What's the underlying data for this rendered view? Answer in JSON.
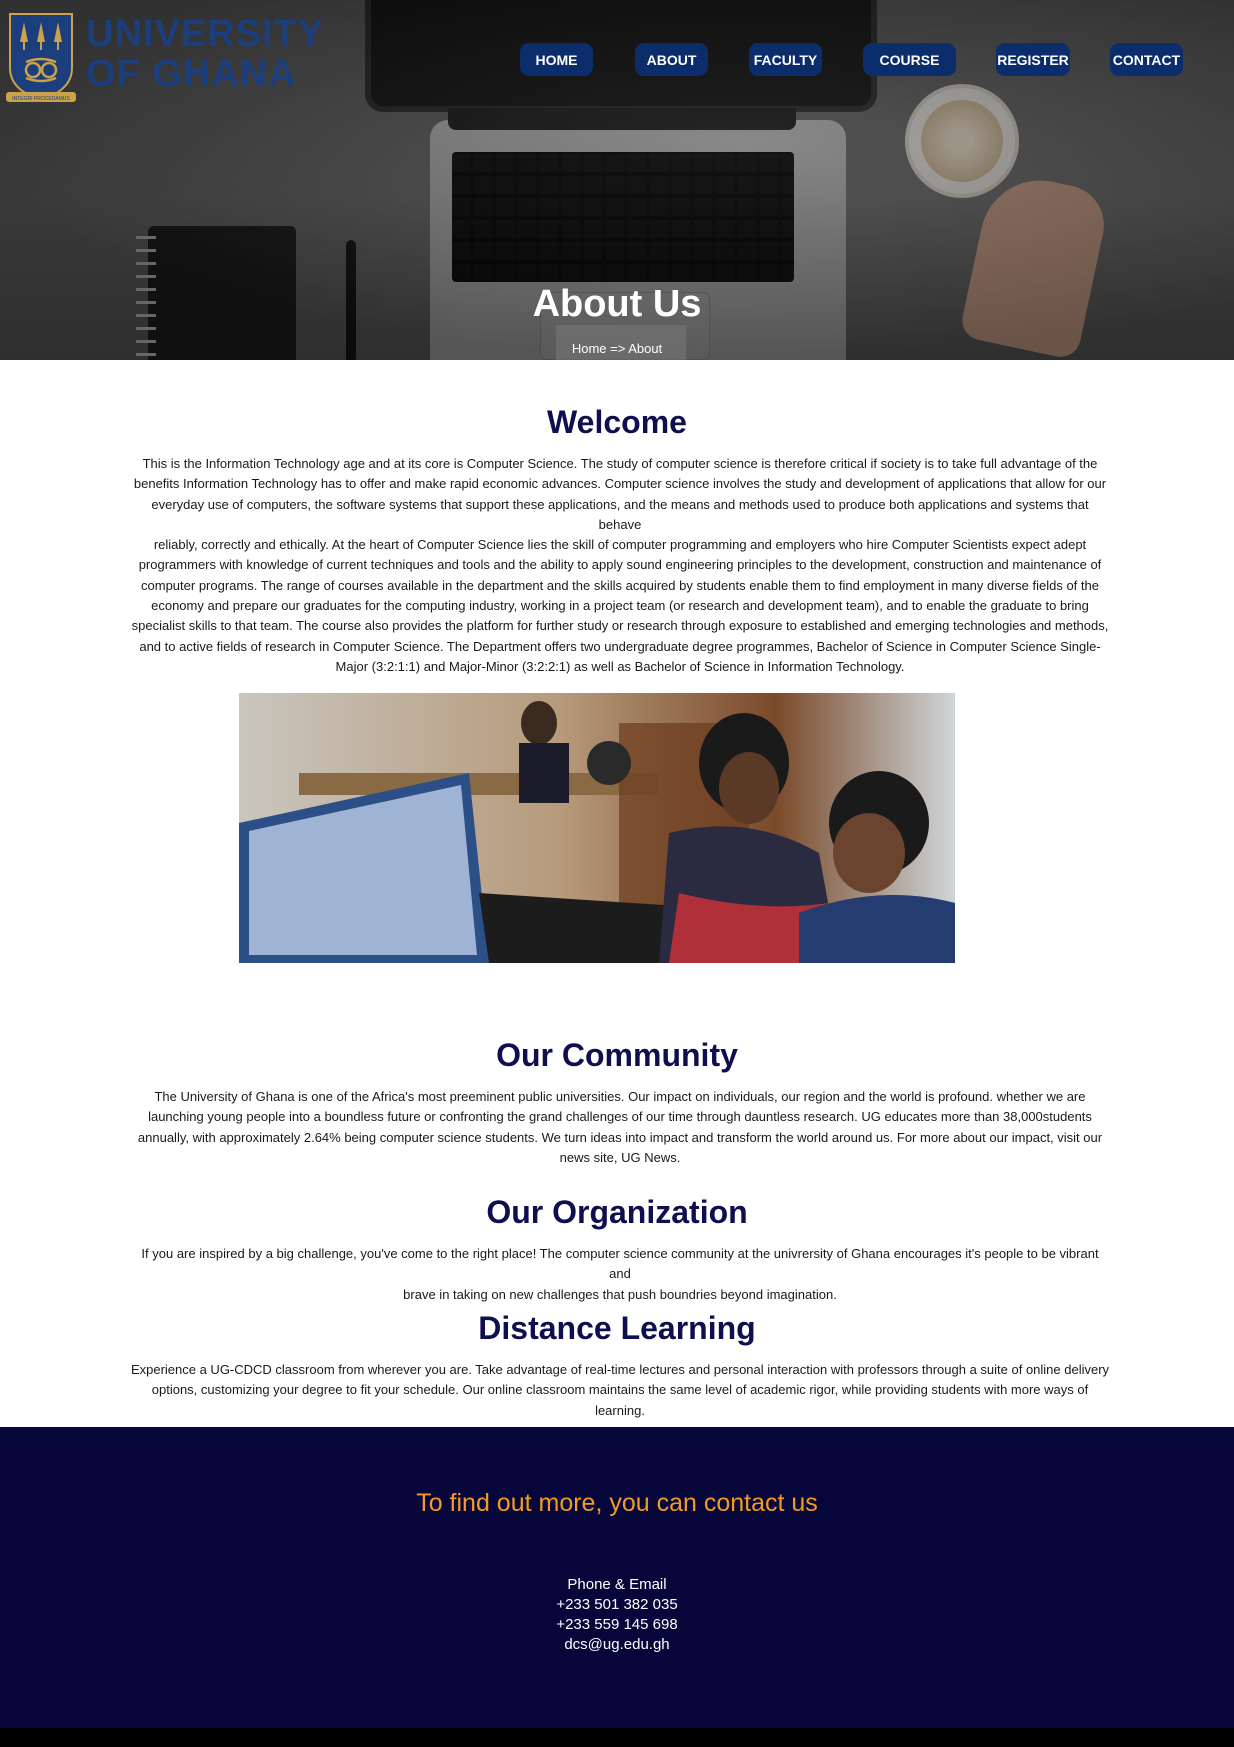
{
  "logo": {
    "line1": "UNIVERSITY",
    "line2": "OF GHANA",
    "motto": "INTEGRI PROCEDAMUS"
  },
  "nav": {
    "items": [
      {
        "label": "HOME"
      },
      {
        "label": "ABOUT"
      },
      {
        "label": "FACULTY"
      },
      {
        "label": "COURSE"
      },
      {
        "label": "REGISTER"
      },
      {
        "label": "CONTACT"
      }
    ]
  },
  "hero": {
    "title": "About Us",
    "breadcrumb": "Home => About"
  },
  "sections": {
    "welcome": {
      "title": "Welcome",
      "lines": [
        "This is the Information Technology age and at its core is Computer Science. The study of computer science is therefore critical if society is to take full advantage of the",
        "benefits Information Technology has to offer and make rapid economic advances. Computer science involves the study and development of applications that allow for our",
        "everyday use of computers, the software systems that support these applications, and the means and methods used to produce both applications and systems that behave",
        "reliably, correctly and ethically. At the heart of Computer Science lies the skill of computer programming and employers who hire Computer Scientists expect adept",
        "programmers with knowledge of current techniques and tools and the ability to apply sound engineering principles to the development, construction and maintenance of",
        "computer programs. The range of courses available in the department and the skills acquired by students enable them to find employment in many diverse fields of the",
        "economy and prepare our graduates for the computing industry, working in a project team (or research and development team), and to enable the graduate to bring",
        "specialist skills to that team. The course also provides the platform for further study or research through exposure to established and emerging technologies and methods,",
        "and to active fields of research in Computer Science. The Department offers two undergraduate degree programmes, Bachelor of Science in Computer Science Single-",
        "Major (3:2:1:1) and Major-Minor (3:2:2:1) as well as Bachelor of Science in Information Technology."
      ]
    },
    "community": {
      "title": "Our Community",
      "lines": [
        "The University of Ghana is one of the Africa's most preeminent public universities. Our impact on individuals, our region and the world is profound. whether we are",
        "launching young people into a boundless future or confronting the grand challenges of our time through dauntless research. UG educates more than 38,000students",
        "annually, with approximately 2.64% being computer science students. We turn ideas into impact and transform the world around us. For more about our impact, visit our",
        "news site, UG News."
      ]
    },
    "organization": {
      "title": "Our Organization",
      "lines": [
        "If you are inspired by a big challenge, you've come to the right place! The computer science community at the univrersity of Ghana encourages it's people to be vibrant and",
        "brave in taking on new challenges that push boundries beyond imagination."
      ]
    },
    "distance": {
      "title": "Distance Learning",
      "lines": [
        "Experience a UG-CDCD classroom from wherever you are. Take advantage of real-time lectures and personal interaction with professors through a suite of online delivery",
        "options, customizing your degree to fit your schedule. Our online classroom maintains the same level of academic rigor, while providing students with more ways of learning."
      ]
    }
  },
  "footer": {
    "cta": "To find out more, you can contact us",
    "heading": "Phone & Email",
    "phone1": "+233 501 382 035",
    "phone2": "+233 559 145 698",
    "email": "dcs@ug.edu.gh"
  },
  "colors": {
    "nav_button": "#0c2d6b",
    "heading": "#0d0f4e",
    "footer_bg": "#06063a",
    "cta": "#f39a25"
  }
}
